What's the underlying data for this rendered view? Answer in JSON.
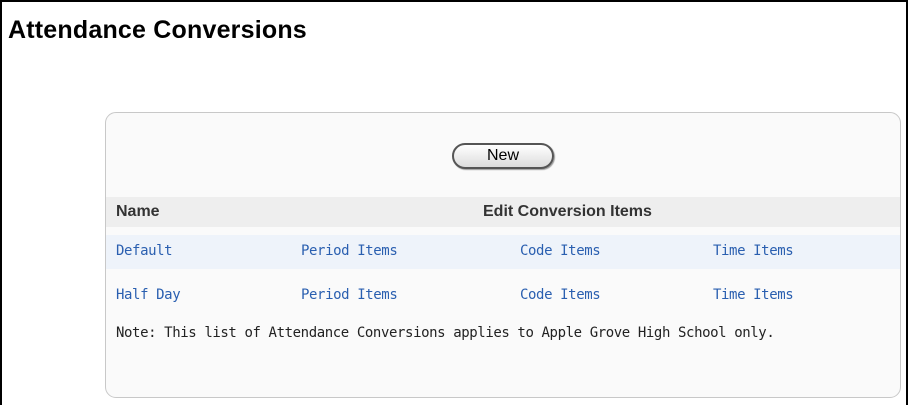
{
  "page": {
    "title": "Attendance Conversions"
  },
  "toolbar": {
    "new_label": "New"
  },
  "table": {
    "headers": {
      "name": "Name",
      "edit": "Edit Conversion Items"
    },
    "rows": [
      {
        "name": "Default",
        "period": "Period Items",
        "code": "Code Items",
        "time": "Time Items"
      },
      {
        "name": "Half Day",
        "period": "Period Items",
        "code": "Code Items",
        "time": "Time Items"
      }
    ]
  },
  "note": "Note: This list of Attendance Conversions applies to Apple Grove High School only.",
  "colors": {
    "link": "#2a5fb0",
    "row_shade": "#eef3fa",
    "header_bg": "#eeeeee",
    "panel_border": "#c8c8c8"
  }
}
